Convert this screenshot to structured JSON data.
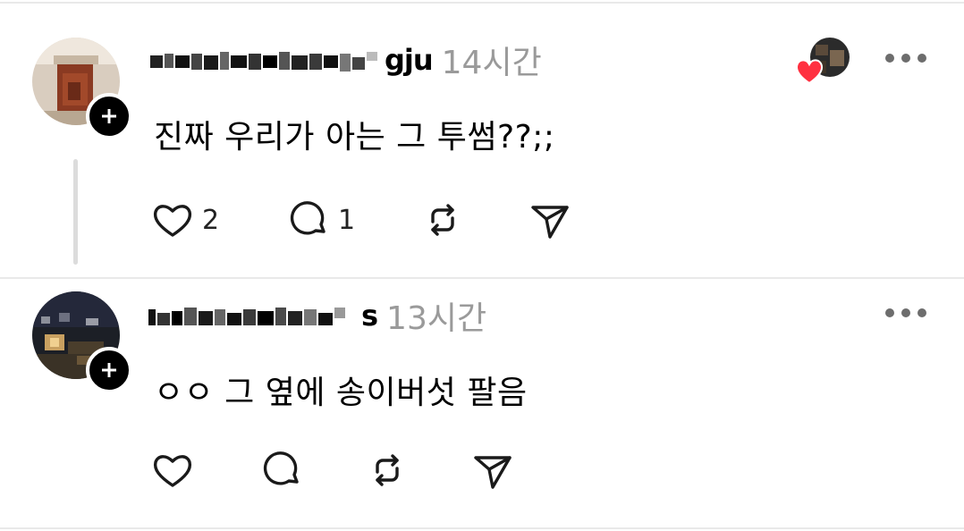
{
  "replies": [
    {
      "username_visible_suffix": "gju",
      "time": "14시간",
      "text": "진짜 우리가 아는 그 투썸??;;",
      "likes": "2",
      "comments": "1"
    },
    {
      "username_visible_suffix": "s",
      "time": "13시간",
      "text": "ㅇㅇ 그 옆에 송이버섯 팔음"
    }
  ],
  "icons": {
    "like": "heart-icon",
    "comment": "speech-bubble-icon",
    "repost": "repost-arrows-icon",
    "share": "paper-plane-icon",
    "more": "more-horizontal-icon",
    "follow": "plus-icon",
    "liked_badge": "red-heart-icon"
  },
  "colors": {
    "text": "#000000",
    "timestamp": "#9a9a9a",
    "icon": "#1a1a1a",
    "like_badge": "#ff3040",
    "divider": "#e9e9e9"
  }
}
